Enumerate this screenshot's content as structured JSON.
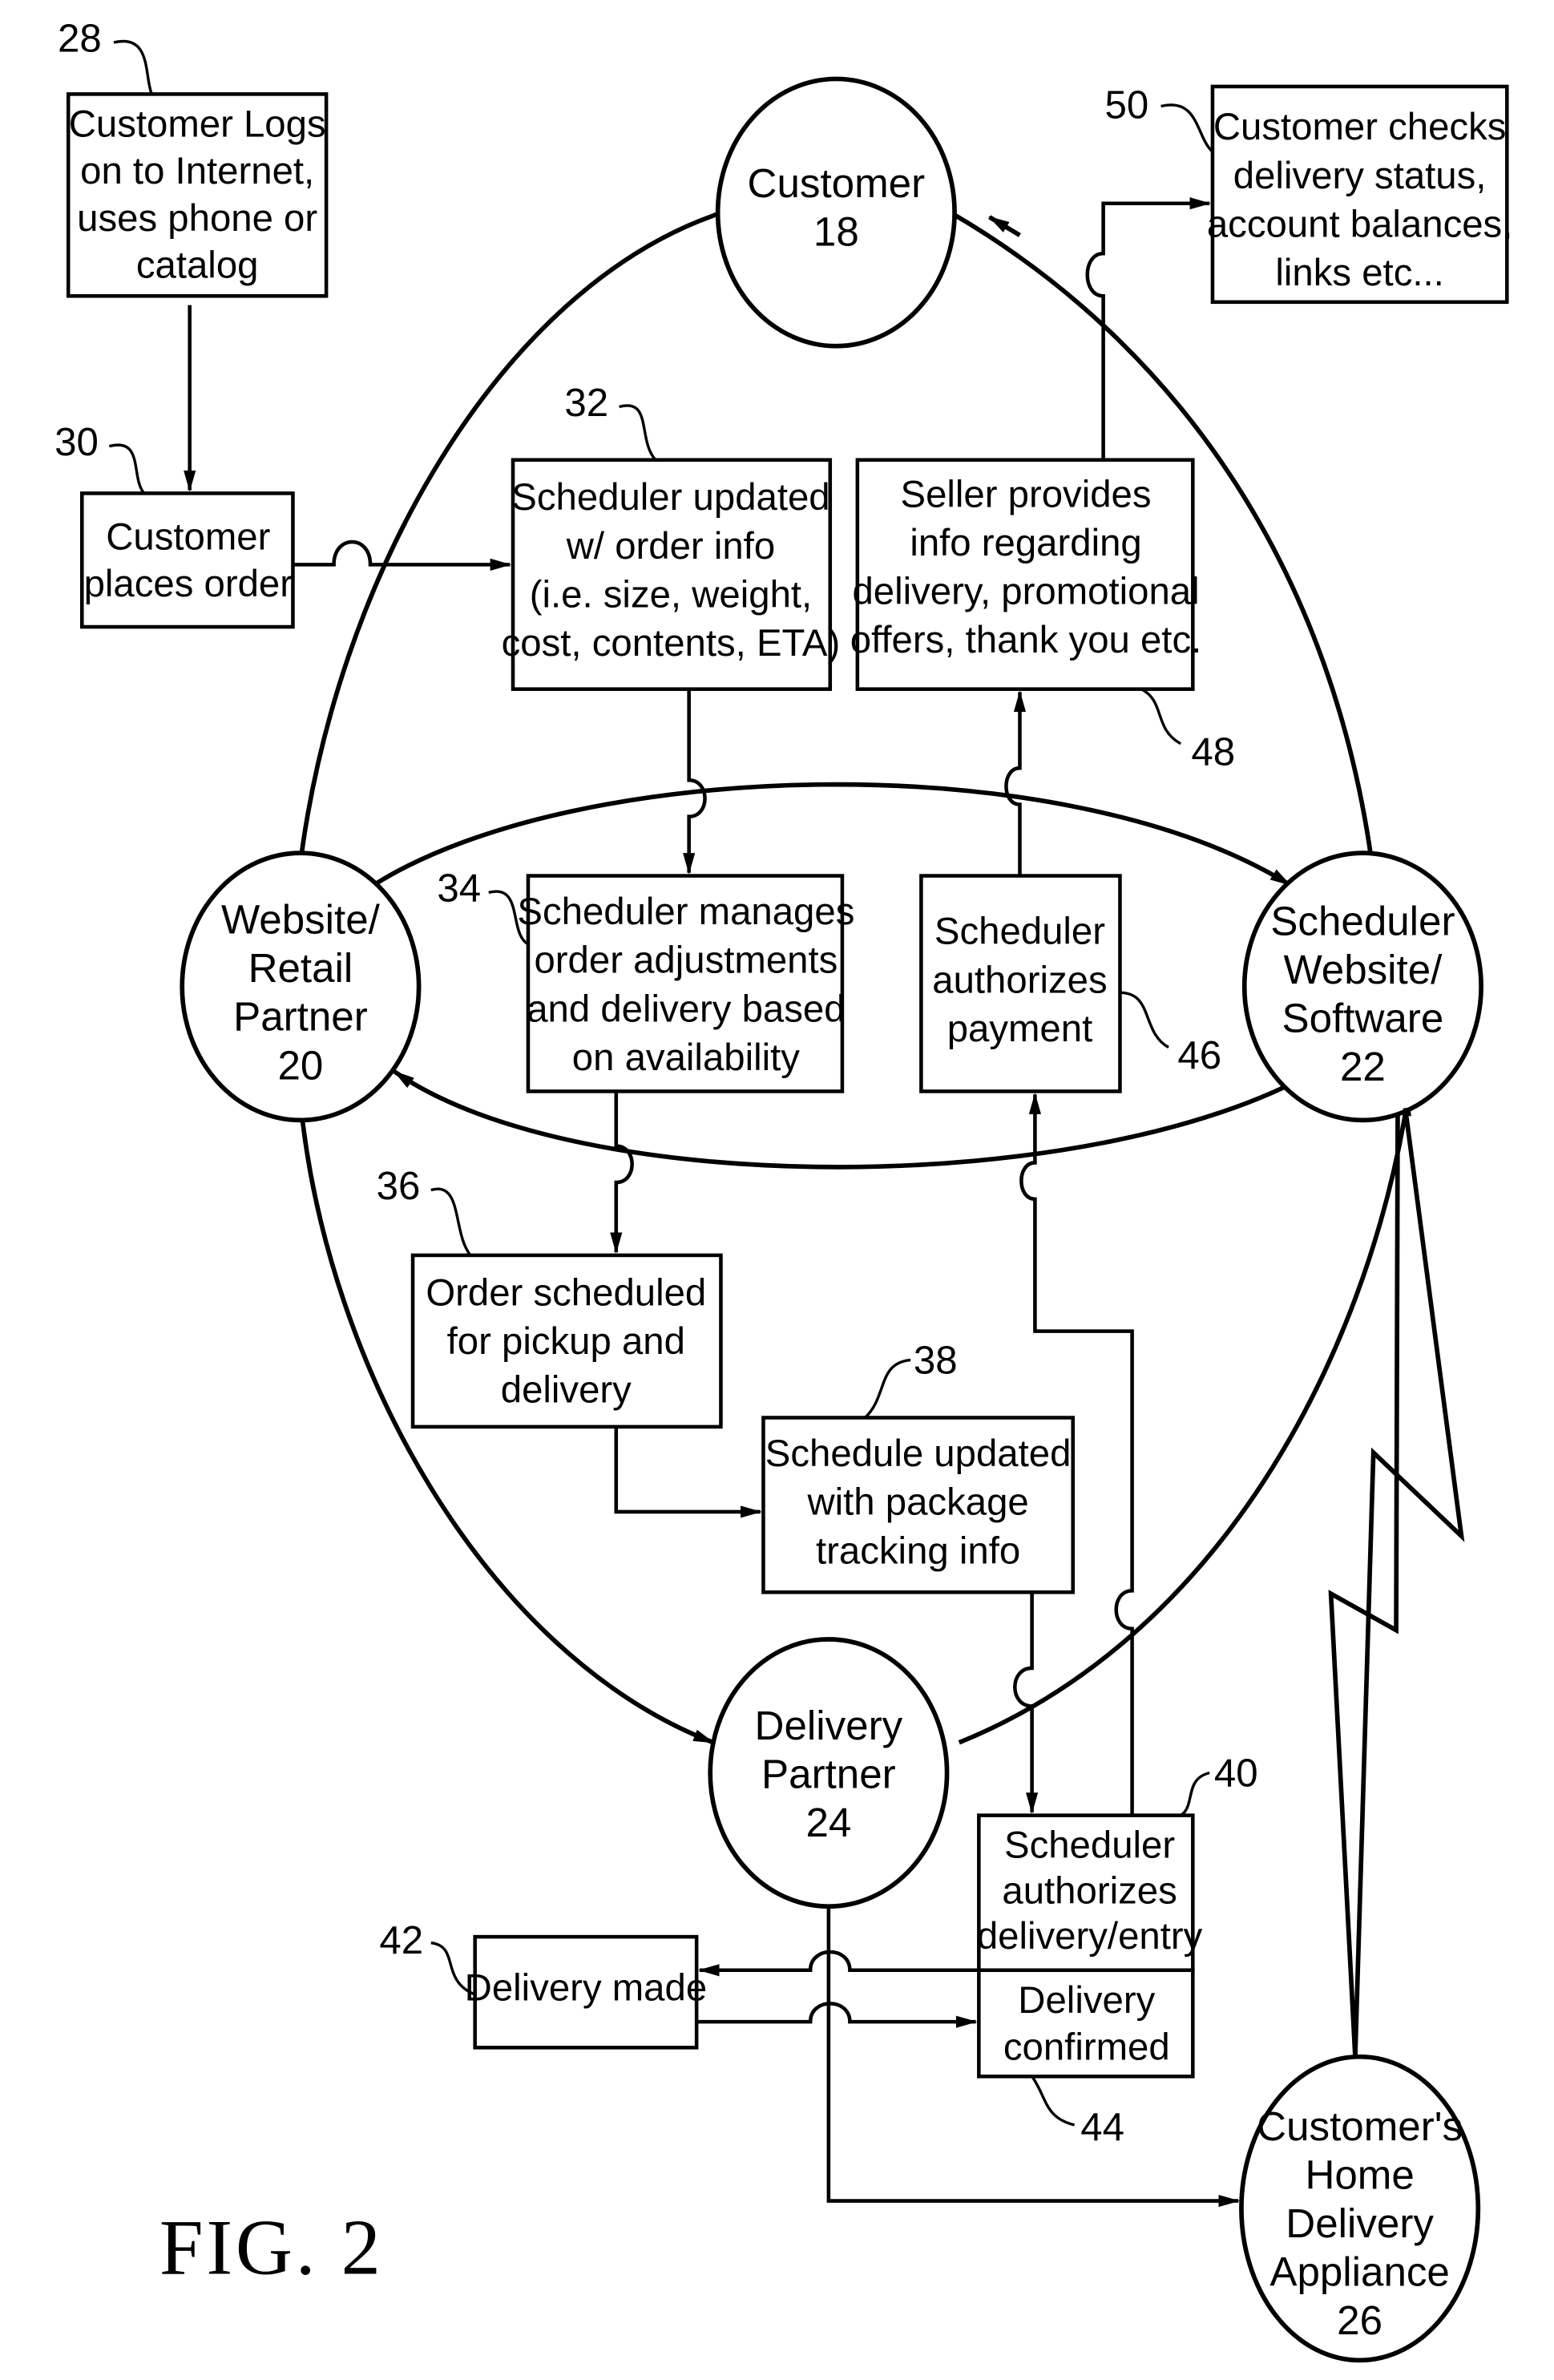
{
  "figure": {
    "caption": "FIG. 2"
  },
  "nodes": {
    "customer": {
      "lines": [
        "Customer",
        "18"
      ]
    },
    "website_retail": {
      "lines": [
        "Website/",
        "Retail",
        "Partner",
        "20"
      ]
    },
    "scheduler": {
      "lines": [
        "Scheduler",
        "Website/",
        "Software",
        "22"
      ]
    },
    "delivery_partner": {
      "lines": [
        "Delivery",
        "Partner",
        "24"
      ]
    },
    "home_appliance": {
      "lines": [
        "Customer's",
        "Home",
        "Delivery",
        "Appliance",
        "26"
      ]
    }
  },
  "boxes": {
    "b28": {
      "ref": "28",
      "lines": [
        "Customer Logs",
        "on to Internet,",
        "uses phone or",
        "catalog"
      ]
    },
    "b30": {
      "ref": "30",
      "lines": [
        "Customer",
        "places order"
      ]
    },
    "b32": {
      "ref": "32",
      "lines": [
        "Scheduler updated",
        "w/ order info",
        "(i.e. size, weight,",
        "cost, contents, ETA)"
      ]
    },
    "b34": {
      "ref": "34",
      "lines": [
        "Scheduler manages",
        "order adjustments",
        "and delivery based",
        "on availability"
      ]
    },
    "b36": {
      "ref": "36",
      "lines": [
        "Order scheduled",
        "for pickup and",
        "delivery"
      ]
    },
    "b38": {
      "ref": "38",
      "lines": [
        "Schedule updated",
        "with package",
        "tracking info"
      ]
    },
    "b40": {
      "ref": "40",
      "lines": [
        "Scheduler",
        "authorizes",
        "delivery/entry"
      ]
    },
    "b42": {
      "ref": "42",
      "lines": [
        "Delivery made"
      ]
    },
    "b44": {
      "ref": "44",
      "lines": [
        "Delivery",
        "confirmed"
      ]
    },
    "b46": {
      "ref": "46",
      "lines": [
        "Scheduler",
        "authorizes",
        "payment"
      ]
    },
    "b48": {
      "ref": "48",
      "lines": [
        "Seller provides",
        "info regarding",
        "delivery, promotional",
        "offers, thank you etc."
      ]
    },
    "b50": {
      "ref": "50",
      "lines": [
        "Customer checks",
        "delivery status,",
        "account balances,",
        "links etc..."
      ]
    }
  }
}
